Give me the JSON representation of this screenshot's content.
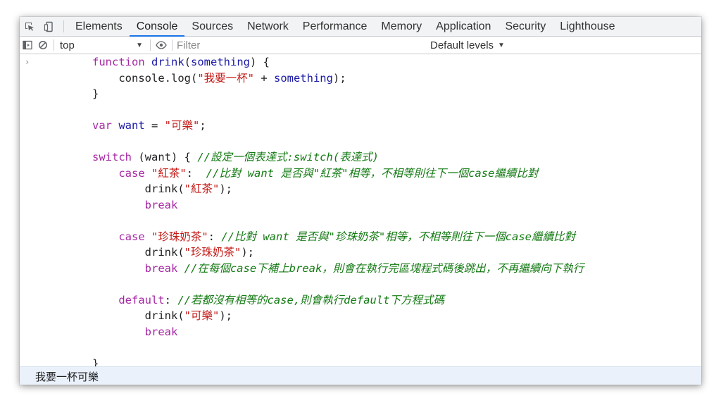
{
  "tabs": [
    "Elements",
    "Console",
    "Sources",
    "Network",
    "Performance",
    "Memory",
    "Application",
    "Security",
    "Lighthouse"
  ],
  "active_tab": "Console",
  "toolbar": {
    "context": "top",
    "filter_placeholder": "Filter",
    "levels": "Default levels"
  },
  "prompt_chevron": "›",
  "code": [
    {
      "indent": 0,
      "tokens": [
        [
          "kw",
          "function "
        ],
        [
          "fn",
          "drink"
        ],
        [
          "plain",
          "("
        ],
        [
          "ident",
          "something"
        ],
        [
          "plain",
          ") {"
        ]
      ]
    },
    {
      "indent": 1,
      "tokens": [
        [
          "plain",
          "console.log("
        ],
        [
          "str",
          "\"我要一杯\""
        ],
        [
          "plain",
          " + "
        ],
        [
          "ident",
          "something"
        ],
        [
          "plain",
          ");"
        ]
      ]
    },
    {
      "indent": 0,
      "tokens": [
        [
          "plain",
          "}"
        ]
      ]
    },
    {
      "indent": 0,
      "tokens": []
    },
    {
      "indent": 0,
      "tokens": [
        [
          "kw",
          "var "
        ],
        [
          "ident",
          "want"
        ],
        [
          "plain",
          " = "
        ],
        [
          "str",
          "\"可樂\""
        ],
        [
          "plain",
          ";"
        ]
      ]
    },
    {
      "indent": 0,
      "tokens": []
    },
    {
      "indent": 0,
      "tokens": [
        [
          "kw",
          "switch"
        ],
        [
          "plain",
          " (want) { "
        ],
        [
          "cmt",
          "//設定一個表達式:switch(表達式)"
        ]
      ]
    },
    {
      "indent": 1,
      "tokens": [
        [
          "kw",
          "case "
        ],
        [
          "str",
          "\"紅茶\""
        ],
        [
          "plain",
          ":  "
        ],
        [
          "cmt",
          "//比對 want 是否與\"紅茶\"相等，不相等則往下一個case繼續比對"
        ]
      ]
    },
    {
      "indent": 2,
      "tokens": [
        [
          "plain",
          "drink("
        ],
        [
          "str",
          "\"紅茶\""
        ],
        [
          "plain",
          ");"
        ]
      ]
    },
    {
      "indent": 2,
      "tokens": [
        [
          "kw",
          "break"
        ]
      ]
    },
    {
      "indent": 0,
      "tokens": []
    },
    {
      "indent": 1,
      "tokens": [
        [
          "kw",
          "case "
        ],
        [
          "str",
          "\"珍珠奶茶\""
        ],
        [
          "plain",
          ": "
        ],
        [
          "cmt",
          "//比對 want 是否與\"珍珠奶茶\"相等，不相等則往下一個case繼續比對"
        ]
      ]
    },
    {
      "indent": 2,
      "tokens": [
        [
          "plain",
          "drink("
        ],
        [
          "str",
          "\"珍珠奶茶\""
        ],
        [
          "plain",
          ");"
        ]
      ]
    },
    {
      "indent": 2,
      "tokens": [
        [
          "kw",
          "break "
        ],
        [
          "cmt",
          "//在每個case下補上break，則會在執行完區塊程式碼後跳出，不再繼續向下執行"
        ]
      ]
    },
    {
      "indent": 0,
      "tokens": []
    },
    {
      "indent": 1,
      "tokens": [
        [
          "kw",
          "default"
        ],
        [
          "plain",
          ": "
        ],
        [
          "cmt",
          "//若都沒有相等的case,則會執行default下方程式碼"
        ]
      ]
    },
    {
      "indent": 2,
      "tokens": [
        [
          "plain",
          "drink("
        ],
        [
          "str",
          "\"可樂\""
        ],
        [
          "plain",
          ");"
        ]
      ]
    },
    {
      "indent": 2,
      "tokens": [
        [
          "kw",
          "break"
        ]
      ]
    },
    {
      "indent": 0,
      "tokens": []
    },
    {
      "indent": 0,
      "tokens": [
        [
          "plain",
          "}"
        ]
      ]
    }
  ],
  "output": "我要一杯可樂"
}
